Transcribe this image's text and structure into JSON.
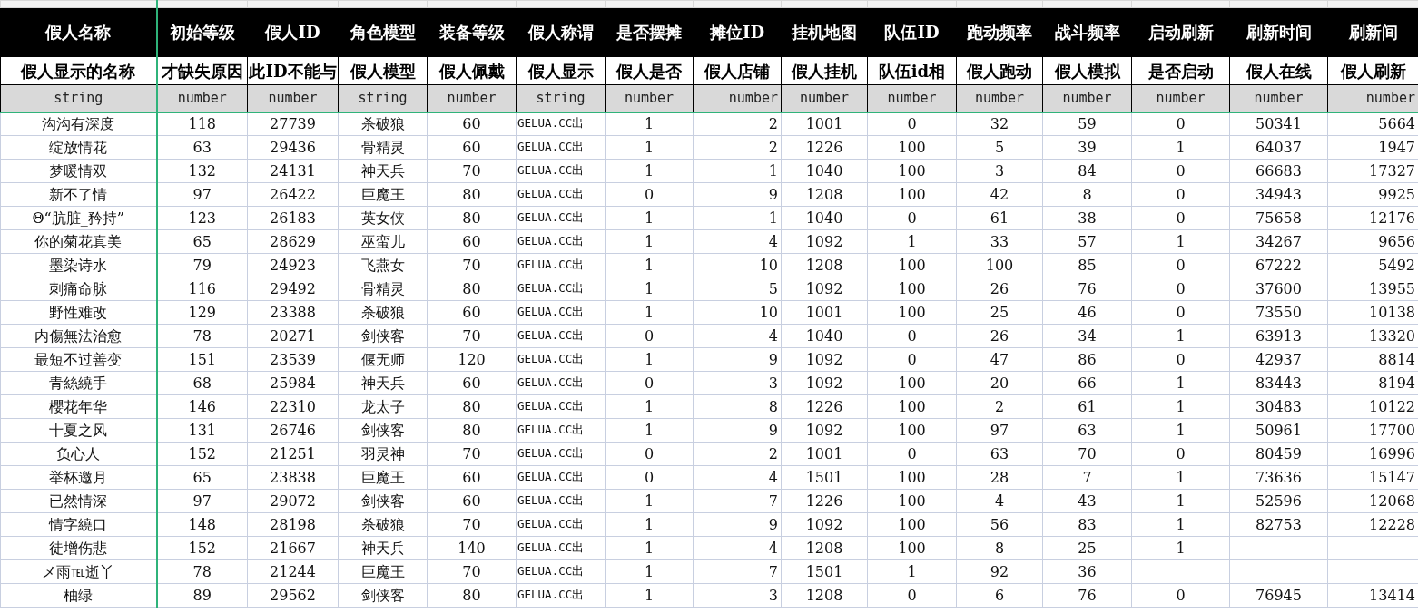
{
  "table": {
    "columns": [
      {
        "name": "假人名称",
        "description": "假人显示的名称",
        "type": "string"
      },
      {
        "name": "初始等级",
        "description": "才缺失原因",
        "type": "number"
      },
      {
        "name": "假人ID",
        "description": "此ID不能与",
        "type": "number"
      },
      {
        "name": "角色模型",
        "description": "假人模型",
        "type": "string"
      },
      {
        "name": "装备等级",
        "description": "假人佩戴",
        "type": "number"
      },
      {
        "name": "假人称谓",
        "description": "假人显示",
        "type": "string"
      },
      {
        "name": "是否摆摊",
        "description": "假人是否",
        "type": "number"
      },
      {
        "name": "摊位ID",
        "description": "假人店铺",
        "type": "number"
      },
      {
        "name": "挂机地图",
        "description": "假人挂机",
        "type": "number"
      },
      {
        "name": "队伍ID",
        "description": "队伍id相",
        "type": "number"
      },
      {
        "name": "跑动频率",
        "description": "假人跑动",
        "type": "number"
      },
      {
        "name": "战斗频率",
        "description": "假人模拟",
        "type": "number"
      },
      {
        "name": "启动刷新",
        "description": "是否启动",
        "type": "number"
      },
      {
        "name": "刷新时间",
        "description": "假人在线",
        "type": "number"
      },
      {
        "name": "刷新间",
        "description": "假人刷新",
        "type": "number"
      }
    ],
    "rows": [
      [
        "沟沟有深度",
        "118",
        "27739",
        "杀破狼",
        "60",
        "GELUA.CC出",
        "1",
        "2",
        "1001",
        "0",
        "32",
        "59",
        "0",
        "50341",
        "5664"
      ],
      [
        "绽放情花",
        "63",
        "29436",
        "骨精灵",
        "60",
        "GELUA.CC出",
        "1",
        "2",
        "1226",
        "100",
        "5",
        "39",
        "1",
        "64037",
        "1947"
      ],
      [
        "梦暖情双",
        "132",
        "24131",
        "神天兵",
        "70",
        "GELUA.CC出",
        "1",
        "1",
        "1040",
        "100",
        "3",
        "84",
        "0",
        "66683",
        "17327"
      ],
      [
        "新不了情",
        "97",
        "26422",
        "巨魔王",
        "80",
        "GELUA.CC出",
        "0",
        "9",
        "1208",
        "100",
        "42",
        "8",
        "0",
        "34943",
        "9925"
      ],
      [
        "Θ“肮脏_矜持”",
        "123",
        "26183",
        "英女侠",
        "80",
        "GELUA.CC出",
        "1",
        "1",
        "1040",
        "0",
        "61",
        "38",
        "0",
        "75658",
        "12176"
      ],
      [
        "你的菊花真美",
        "65",
        "28629",
        "巫蛮儿",
        "60",
        "GELUA.CC出",
        "1",
        "4",
        "1092",
        "1",
        "33",
        "57",
        "1",
        "34267",
        "9656"
      ],
      [
        "墨染诗水",
        "79",
        "24923",
        "飞燕女",
        "70",
        "GELUA.CC出",
        "1",
        "10",
        "1208",
        "100",
        "100",
        "85",
        "0",
        "67222",
        "5492"
      ],
      [
        "刺痛命脉",
        "116",
        "29492",
        "骨精灵",
        "80",
        "GELUA.CC出",
        "1",
        "5",
        "1092",
        "100",
        "26",
        "76",
        "0",
        "37600",
        "13955"
      ],
      [
        "野性难改",
        "129",
        "23388",
        "杀破狼",
        "60",
        "GELUA.CC出",
        "1",
        "10",
        "1001",
        "100",
        "25",
        "46",
        "0",
        "73550",
        "10138"
      ],
      [
        "内傷無法治愈",
        "78",
        "20271",
        "剑侠客",
        "70",
        "GELUA.CC出",
        "0",
        "4",
        "1040",
        "0",
        "26",
        "34",
        "1",
        "63913",
        "13320"
      ],
      [
        "最短不过善变",
        "151",
        "23539",
        "偃无师",
        "120",
        "GELUA.CC出",
        "1",
        "9",
        "1092",
        "0",
        "47",
        "86",
        "0",
        "42937",
        "8814"
      ],
      [
        "青絲繞手",
        "68",
        "25984",
        "神天兵",
        "60",
        "GELUA.CC出",
        "0",
        "3",
        "1092",
        "100",
        "20",
        "66",
        "1",
        "83443",
        "8194"
      ],
      [
        "櫻花年华",
        "146",
        "22310",
        "龙太子",
        "80",
        "GELUA.CC出",
        "1",
        "8",
        "1226",
        "100",
        "2",
        "61",
        "1",
        "30483",
        "10122"
      ],
      [
        "十夏之风",
        "131",
        "26746",
        "剑侠客",
        "80",
        "GELUA.CC出",
        "1",
        "9",
        "1092",
        "100",
        "97",
        "63",
        "1",
        "50961",
        "17700"
      ],
      [
        "负心人",
        "152",
        "21251",
        "羽灵神",
        "70",
        "GELUA.CC出",
        "0",
        "2",
        "1001",
        "0",
        "63",
        "70",
        "0",
        "80459",
        "16996"
      ],
      [
        "举杯邀月",
        "65",
        "23838",
        "巨魔王",
        "60",
        "GELUA.CC出",
        "0",
        "4",
        "1501",
        "100",
        "28",
        "7",
        "1",
        "73636",
        "15147"
      ],
      [
        "已然情深",
        "97",
        "29072",
        "剑侠客",
        "60",
        "GELUA.CC出",
        "1",
        "7",
        "1226",
        "100",
        "4",
        "43",
        "1",
        "52596",
        "12068"
      ],
      [
        "情字繞口",
        "148",
        "28198",
        "杀破狼",
        "70",
        "GELUA.CC出",
        "1",
        "9",
        "1092",
        "100",
        "56",
        "83",
        "1",
        "82753",
        "12228"
      ],
      [
        "徒增伤悲",
        "152",
        "21667",
        "神天兵",
        "140",
        "GELUA.CC出",
        "1",
        "4",
        "1208",
        "100",
        "8",
        "25",
        "1",
        null,
        null
      ],
      [
        "メ雨℡逝丫",
        "78",
        "21244",
        "巨魔王",
        "70",
        "GELUA.CC出",
        "1",
        "7",
        "1501",
        "1",
        "92",
        "36",
        null,
        null,
        null
      ],
      [
        "柚绿",
        "89",
        "29562",
        "剑侠客",
        "80",
        "GELUA.CC出",
        "1",
        "3",
        "1208",
        "0",
        "6",
        "76",
        "0",
        "76945",
        "13414"
      ]
    ]
  }
}
